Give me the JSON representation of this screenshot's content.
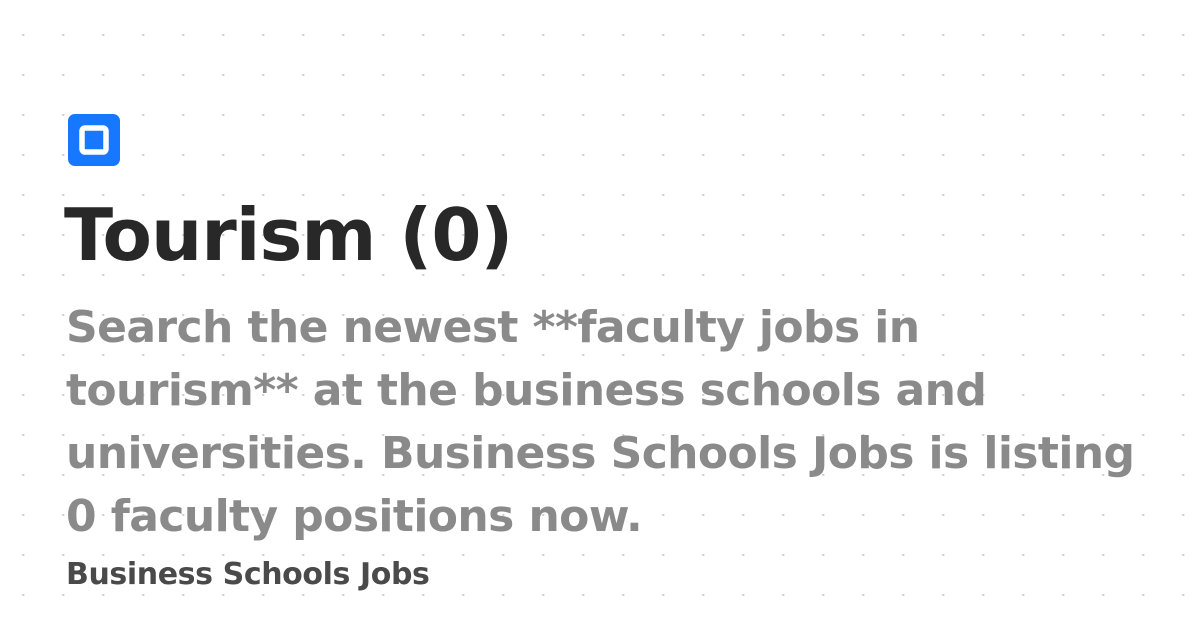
{
  "page": {
    "background_color": "#ffffff",
    "accent_color": "#1677ff",
    "title": "Tourism (0)",
    "description": "Search the newest **faculty jobs in tourism** at the business schools and universities. Business Schools Jobs is listing 0 faculty positions now.",
    "site_name": "Business Schools Jobs",
    "logo_icon": "square-logo-icon"
  }
}
